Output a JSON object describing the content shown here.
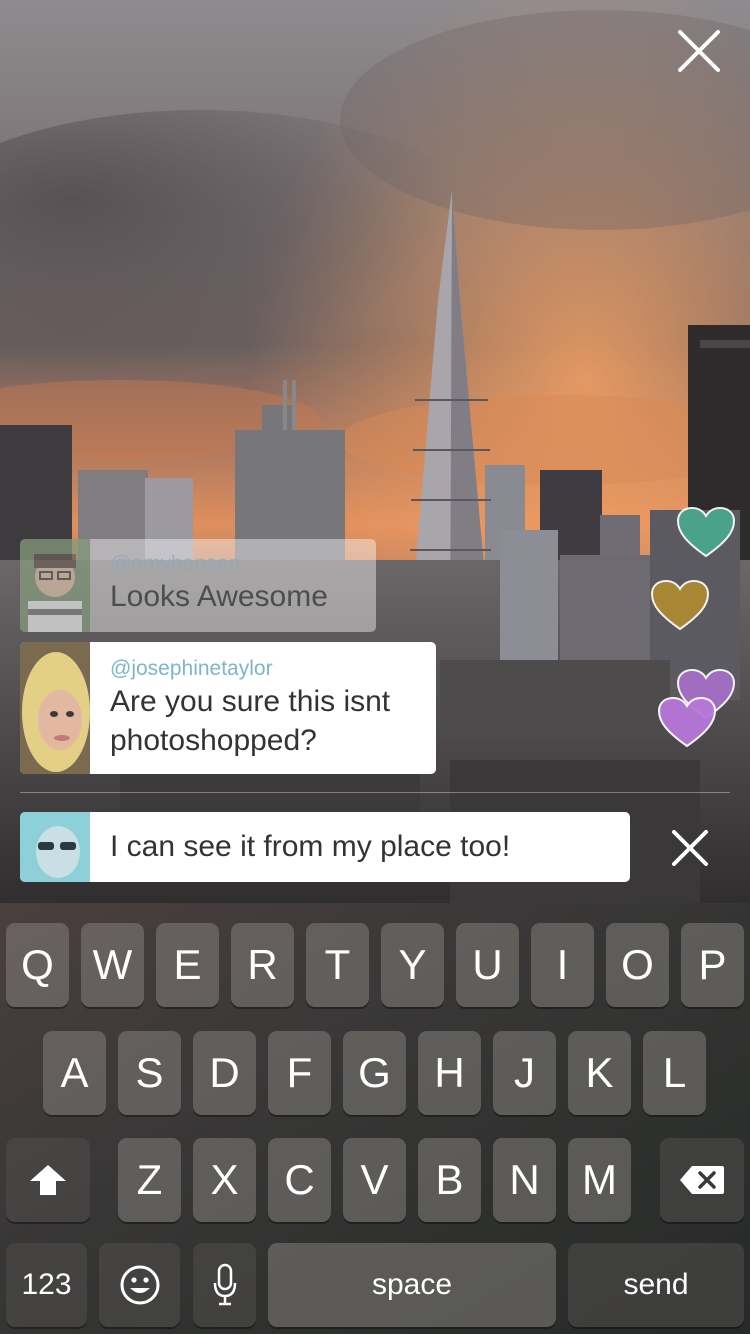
{
  "close_icon": "close-x-icon",
  "comments": [
    {
      "username": "@emyhansen",
      "message": "Looks Awesome",
      "avatar": "avatar-emyhansen"
    },
    {
      "username": "@josephinetaylor",
      "message": "Are you sure this isnt photoshopped?",
      "avatar": "avatar-josephinetaylor"
    }
  ],
  "composer": {
    "text": "I can see it from my place too!",
    "cancel_icon": "close-x-icon"
  },
  "hearts": [
    {
      "color": "#4aa98e"
    },
    {
      "color": "#b08a30"
    },
    {
      "color": "#a66fc9"
    },
    {
      "color": "#b877d9"
    }
  ],
  "keyboard": {
    "row1": [
      "Q",
      "W",
      "E",
      "R",
      "T",
      "Y",
      "U",
      "I",
      "O",
      "P"
    ],
    "row2": [
      "A",
      "S",
      "D",
      "F",
      "G",
      "H",
      "J",
      "K",
      "L"
    ],
    "row3": [
      "Z",
      "X",
      "C",
      "V",
      "B",
      "N",
      "M"
    ],
    "numbers": "123",
    "space": "space",
    "send": "send",
    "shift_icon": "shift-arrow-icon",
    "backspace_icon": "backspace-icon",
    "emoji_icon": "emoji-face-icon",
    "mic_icon": "microphone-icon"
  }
}
